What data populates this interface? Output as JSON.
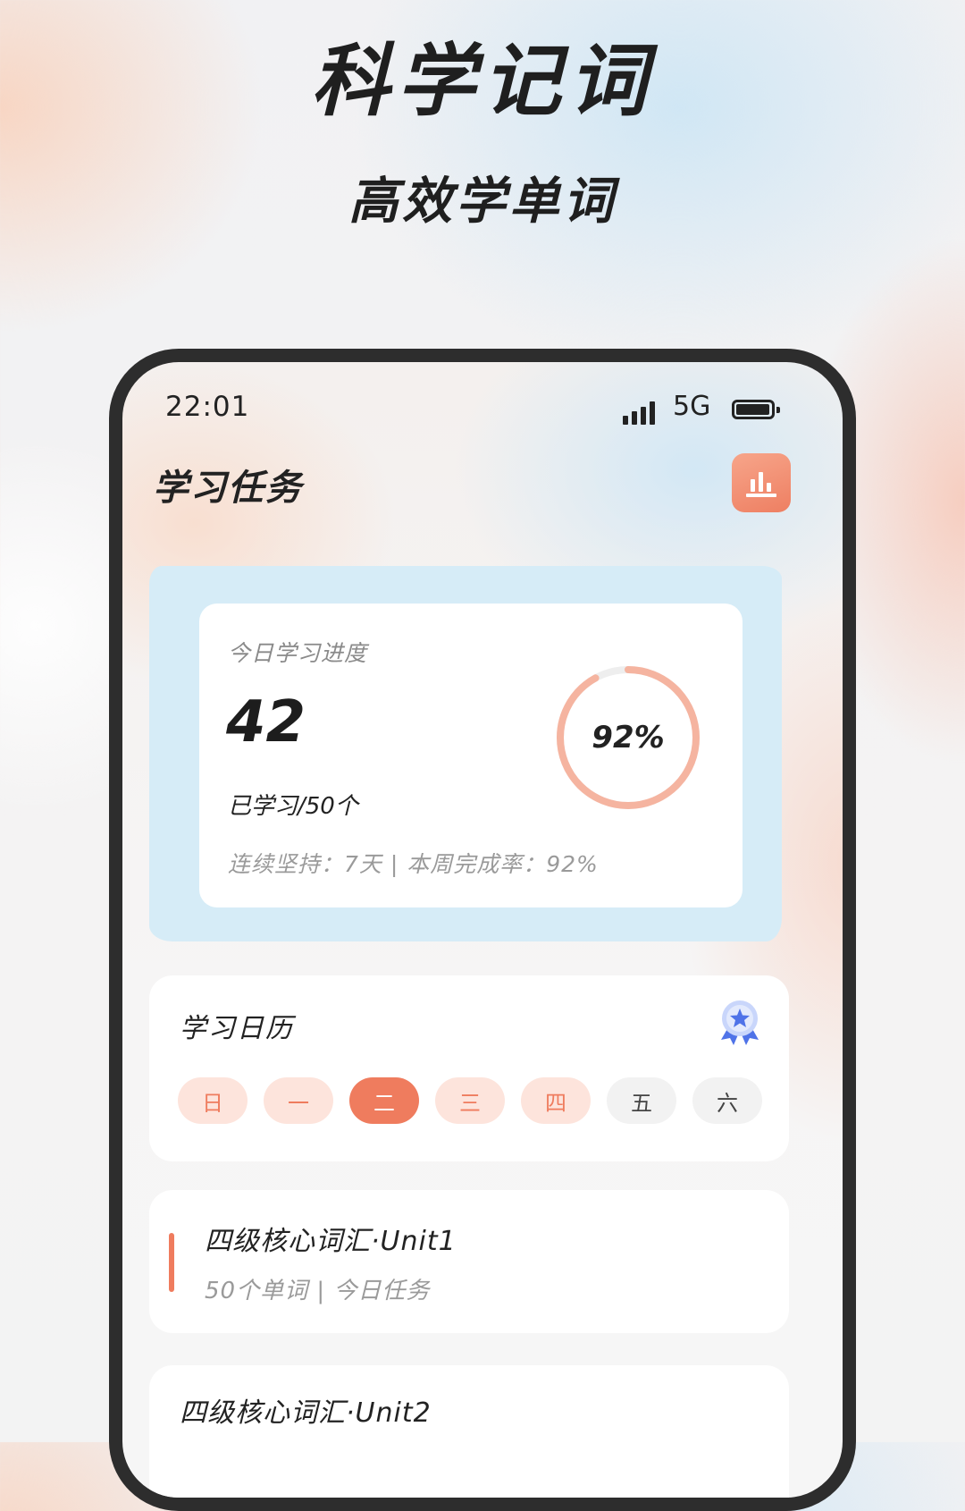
{
  "promo": {
    "headline": "科学记词",
    "subheadline": "高效学单词"
  },
  "status_bar": {
    "time": "22:01",
    "network": "5G"
  },
  "header": {
    "title": "学习任务",
    "stats_icon": "bar-chart-icon"
  },
  "progress_card": {
    "label": "今日学习进度",
    "count": "42",
    "learned_text": "已学习/50个",
    "percent_text": "92%",
    "percent_value": 0.92,
    "streak_text": "连续坚持：7天 | 本周完成率：92%"
  },
  "calendar": {
    "title": "学习日历",
    "medal_icon": "medal-icon",
    "days": [
      {
        "label": "日",
        "state": "done"
      },
      {
        "label": "一",
        "state": "done"
      },
      {
        "label": "二",
        "state": "today"
      },
      {
        "label": "三",
        "state": "done"
      },
      {
        "label": "四",
        "state": "done"
      },
      {
        "label": "五",
        "state": "future"
      },
      {
        "label": "六",
        "state": "future"
      }
    ]
  },
  "tasks": [
    {
      "name": "四级核心词汇·Unit1",
      "meta": "50个单词 | 今日任务"
    },
    {
      "name": "四级核心词汇·Unit2",
      "meta": ""
    }
  ],
  "colors": {
    "accent": "#ef7c5e",
    "accent_light": "#fde4dc",
    "ring": "#f5b4a0",
    "ring_track": "#eeeeee",
    "card_blob": "#d6ecf7"
  }
}
